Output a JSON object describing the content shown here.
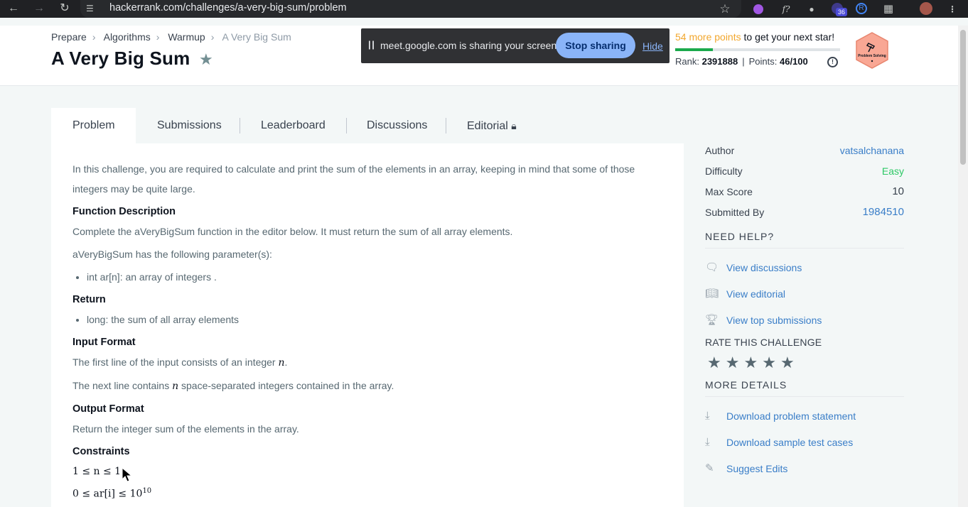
{
  "browser": {
    "url": "hackerrank.com/challenges/a-very-big-sum/problem",
    "ext_badge": "36"
  },
  "breadcrumb": [
    "Prepare",
    "Algorithms",
    "Warmup",
    "A Very Big Sum"
  ],
  "title": "A Very Big Sum",
  "share_banner": {
    "message": "meet.google.com is sharing your screen.",
    "stop_label": "Stop sharing",
    "hide_label": "Hide"
  },
  "points": {
    "more_points": "54 more points",
    "suffix": " to get your next star!",
    "progress_fraction": 0.23,
    "rank_label": "Rank:",
    "rank_value": "2391888",
    "points_label": "Points:",
    "points_value": "46/100"
  },
  "badge": {
    "label": "Problem Solving"
  },
  "tabs": [
    "Problem",
    "Submissions",
    "Leaderboard",
    "Discussions",
    "Editorial"
  ],
  "problem": {
    "intro": "In this challenge, you are required to calculate and print the sum of the elements in an array, keeping in mind that some of those integers may be quite large.",
    "function_heading": "Function Description",
    "function_desc": "Complete the aVeryBigSum function in the editor below. It must return the sum of all array elements.",
    "params_intro": "aVeryBigSum has the following parameter(s):",
    "param_1": "int ar[n]: an array of integers .",
    "return_heading": "Return",
    "return_1": "long: the sum of all array elements",
    "input_heading": "Input Format",
    "input_line1_a": "The first line of the input consists of an integer ",
    "input_line1_var": "n",
    "input_line1_b": ".",
    "input_line2_a": "The next line contains ",
    "input_line2_var": "n",
    "input_line2_b": " space-separated integers contained in the array.",
    "output_heading": "Output Format",
    "output_desc": "Return the integer sum of the elements in the array.",
    "constraints_heading": "Constraints",
    "constraint_1": "1 ≤ n ≤ 1",
    "constraint_2_base": "0 ≤ ar[i] ≤ 10",
    "constraint_2_exp": "10"
  },
  "sidebar": {
    "author_label": "Author",
    "author_value": "vatsalchanana",
    "difficulty_label": "Difficulty",
    "difficulty_value": "Easy",
    "max_score_label": "Max Score",
    "max_score_value": "10",
    "submitted_label": "Submitted By",
    "submitted_value": "1984510",
    "need_help": "NEED HELP?",
    "help_links": [
      "View discussions",
      "View editorial",
      "View top submissions"
    ],
    "rate_title": "RATE THIS CHALLENGE",
    "more_details": "MORE DETAILS",
    "detail_links": [
      "Download problem statement",
      "Download sample test cases",
      "Suggest Edits"
    ]
  },
  "colors": {
    "accent_orange": "#f2a72e",
    "link_blue": "#3a7ec8",
    "easy_green": "#2ec866",
    "progress_green": "#1ba94c"
  }
}
